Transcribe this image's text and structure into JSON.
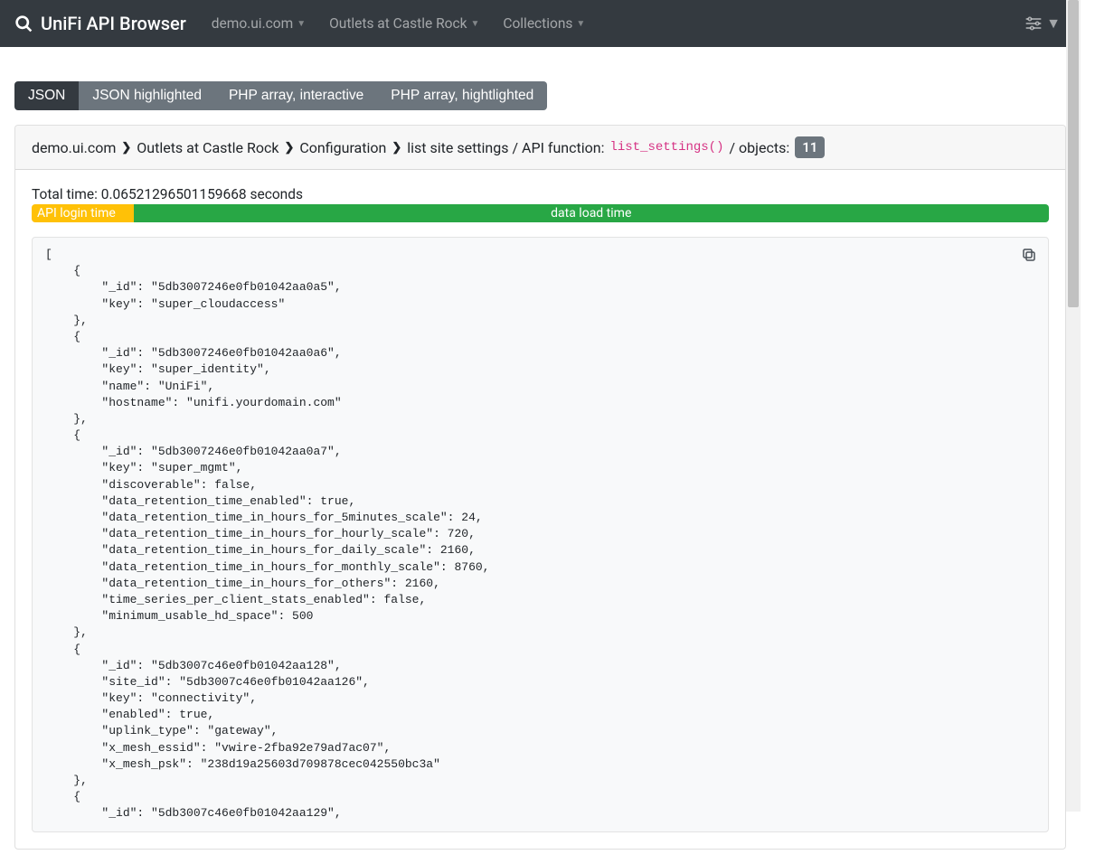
{
  "app": {
    "title": "UniFi API Browser"
  },
  "nav": {
    "controller": "demo.ui.com",
    "site": "Outlets at Castle Rock",
    "collections": "Collections"
  },
  "tabs": {
    "json": "JSON",
    "json_hl": "JSON highlighted",
    "php_int": "PHP array, interactive",
    "php_hl": "PHP array, hightlighted"
  },
  "breadcrumb": {
    "controller": "demo.ui.com",
    "site": "Outlets at Castle Rock",
    "collection": "Configuration",
    "label_pre": "list site settings / API function:",
    "api_fn": "list_settings()",
    "label_post": "/ objects:",
    "object_count": "11"
  },
  "timing": {
    "total_label": "Total time:",
    "total_value": "0.06521296501159668",
    "total_suffix": "seconds",
    "login_label": "API login time",
    "load_label": "data load time"
  },
  "json_output": "[\n    {\n        \"_id\": \"5db3007246e0fb01042aa0a5\",\n        \"key\": \"super_cloudaccess\"\n    },\n    {\n        \"_id\": \"5db3007246e0fb01042aa0a6\",\n        \"key\": \"super_identity\",\n        \"name\": \"UniFi\",\n        \"hostname\": \"unifi.yourdomain.com\"\n    },\n    {\n        \"_id\": \"5db3007246e0fb01042aa0a7\",\n        \"key\": \"super_mgmt\",\n        \"discoverable\": false,\n        \"data_retention_time_enabled\": true,\n        \"data_retention_time_in_hours_for_5minutes_scale\": 24,\n        \"data_retention_time_in_hours_for_hourly_scale\": 720,\n        \"data_retention_time_in_hours_for_daily_scale\": 2160,\n        \"data_retention_time_in_hours_for_monthly_scale\": 8760,\n        \"data_retention_time_in_hours_for_others\": 2160,\n        \"time_series_per_client_stats_enabled\": false,\n        \"minimum_usable_hd_space\": 500\n    },\n    {\n        \"_id\": \"5db3007c46e0fb01042aa128\",\n        \"site_id\": \"5db3007c46e0fb01042aa126\",\n        \"key\": \"connectivity\",\n        \"enabled\": true,\n        \"uplink_type\": \"gateway\",\n        \"x_mesh_essid\": \"vwire-2fba92e79ad7ac07\",\n        \"x_mesh_psk\": \"238d19a25603d709878cec042550bc3a\"\n    },\n    {\n        \"_id\": \"5db3007c46e0fb01042aa129\","
}
